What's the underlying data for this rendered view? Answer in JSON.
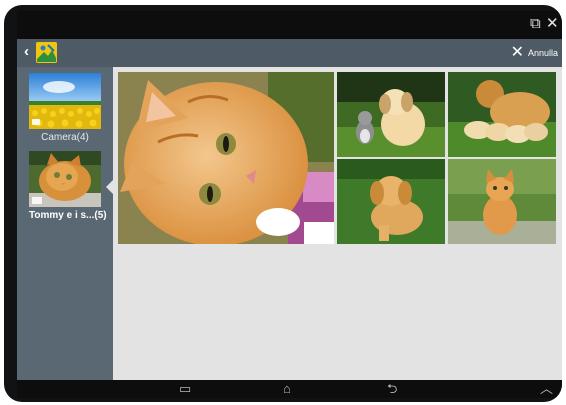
{
  "status_bar": {
    "popup_icon": "pop-out-window-icon",
    "close_icon": "close-icon",
    "popup_glyph": "⧉",
    "close_glyph": "✕"
  },
  "action_bar": {
    "back_glyph": "‹",
    "cancel_glyph": "✕",
    "cancel_label": "Annulla",
    "app_icon": "gallery-app-icon"
  },
  "albums": [
    {
      "label": "Camera(4)",
      "selected": false
    },
    {
      "label": "Tommy e i s...(5)",
      "selected": true
    }
  ],
  "photos": [
    {
      "subject": "orange kitten close-up"
    },
    {
      "subject": "puppy and kitten on grass"
    },
    {
      "subject": "mother dog with puppies"
    },
    {
      "subject": "golden retriever puppy on grass"
    },
    {
      "subject": "orange kitten sitting on grass"
    }
  ],
  "nav_bar": {
    "recent_glyph": "▭",
    "home_glyph": "⌂",
    "back_glyph": "⮌",
    "hide_glyph": "︿"
  },
  "colors": {
    "action_bar": "#4e5b66",
    "sidebar": "#5a6874",
    "content_bg": "#e3e3e3",
    "system_bar": "#0d0d0e"
  }
}
